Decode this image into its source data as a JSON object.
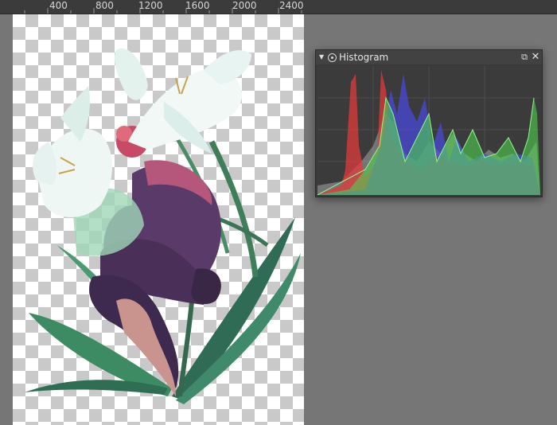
{
  "ruler": {
    "labels": [
      "400",
      "800",
      "1200",
      "1600",
      "2000",
      "2400"
    ]
  },
  "histogram_docker": {
    "title": "Histogram",
    "collapse_icon": "triangle-down-icon",
    "title_icon": "histogram-icon",
    "float_icon": "float-window-icon",
    "close_icon": "close-icon",
    "channel_colors": {
      "red": "#e23b3b",
      "green": "#4fd24f",
      "blue": "#4a4ae6",
      "gray": "#a5a5a5"
    }
  },
  "canvas": {
    "background": "transparent-checkerboard",
    "artwork": "white lilies with green leaves and a dark purple creature"
  }
}
